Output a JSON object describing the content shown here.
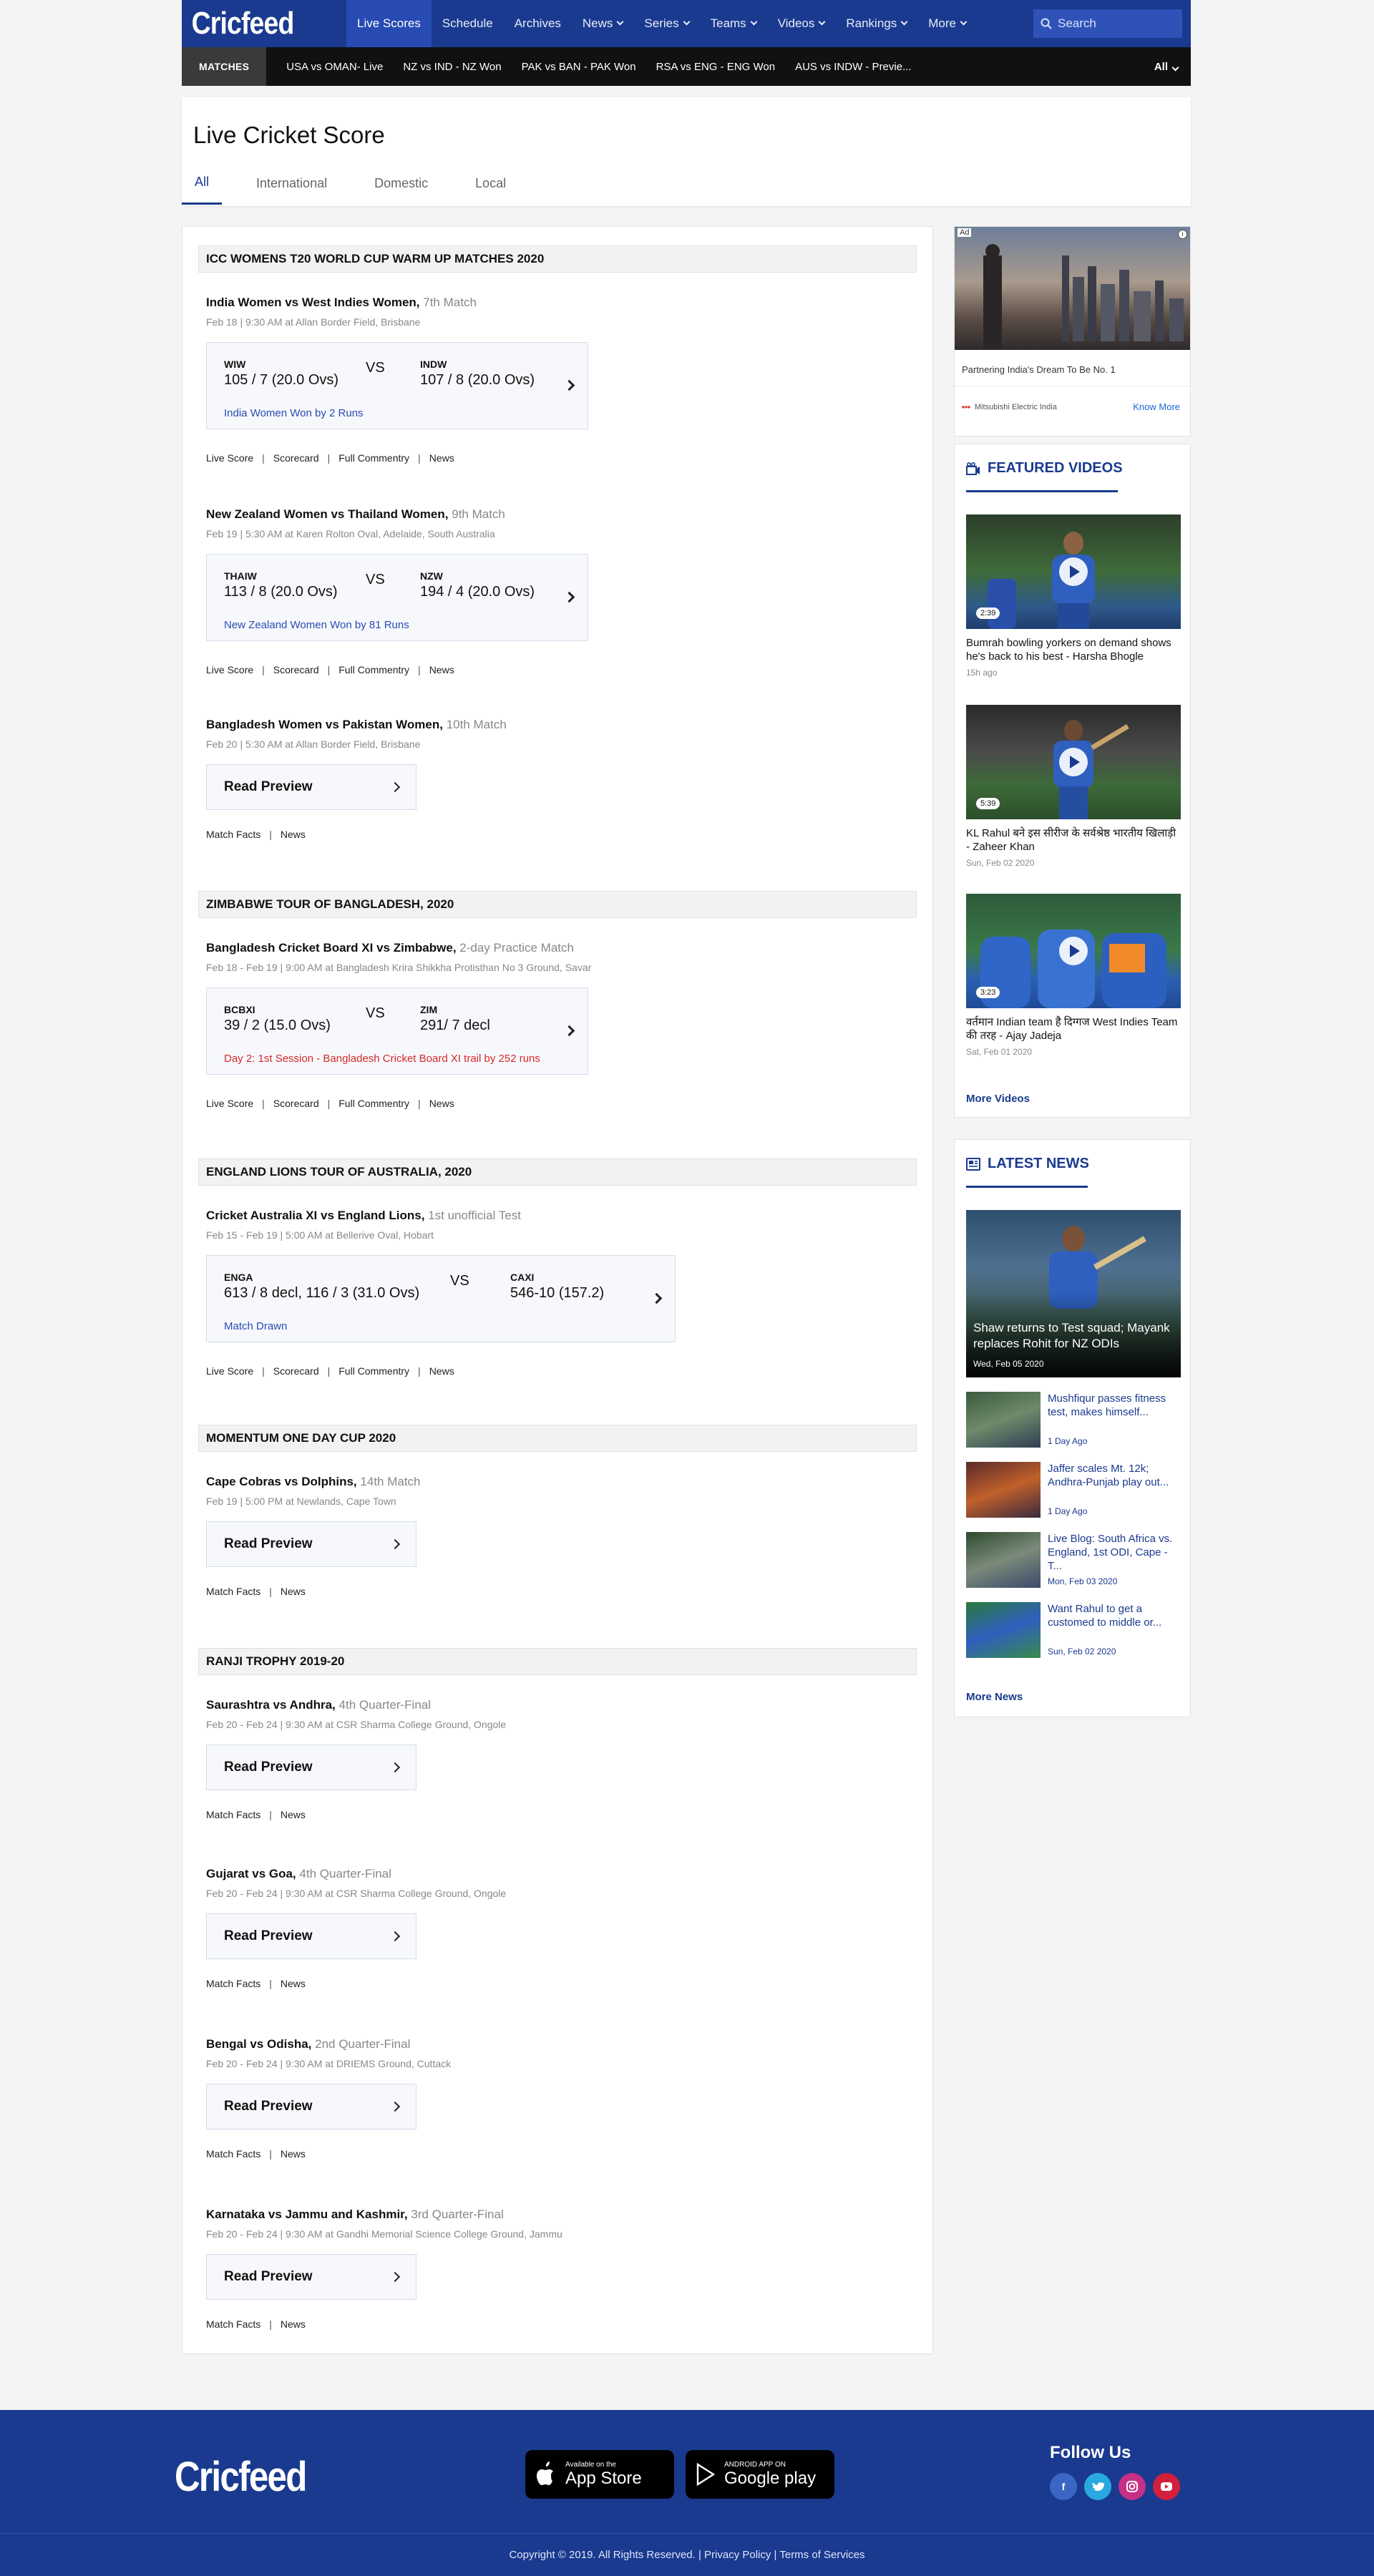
{
  "nav": {
    "logo": "Cricfeed",
    "items": [
      "Live Scores",
      "Schedule",
      "Archives",
      "News",
      "Series",
      "Teams",
      "Videos",
      "Rankings",
      "More"
    ],
    "search_placeholder": "Search"
  },
  "strip": {
    "label": "MATCHES",
    "matches": [
      "USA vs OMAN- Live",
      "NZ vs IND - NZ Won",
      "PAK vs BAN - PAK Won",
      "RSA vs  ENG - ENG Won",
      "AUS vs INDW - Previe..."
    ],
    "filter": "All"
  },
  "header": {
    "title": "Live Cricket Score",
    "tabs": [
      "All",
      "International",
      "Domestic",
      "Local"
    ]
  },
  "sections": [
    "ICC WOMENS T20 WORLD CUP WARM UP MATCHES 2020",
    "ZIMBABWE TOUR OF BANGLADESH, 2020",
    "ENGLAND LIONS TOUR OF AUSTRALIA, 2020",
    "MOMENTUM ONE DAY CUP 2020",
    "RANJI TROPHY 2019-20"
  ],
  "matches": [
    {
      "title": "India Women vs West Indies Women,",
      "num": "7th Match",
      "meta": "Feb 18  |  9:30 AM at Allan Border Field, Brisbane",
      "t1": "WIW",
      "s1": "105 / 7 (20.0 Ovs)",
      "vs": "VS",
      "t2": "INDW",
      "s2": "107 / 8 (20.0 Ovs)",
      "result": "India Women Won by 2 Runs",
      "links": [
        "Live Score",
        "Scorecard",
        "Full Commentry",
        "News"
      ]
    },
    {
      "title": "New Zealand Women vs Thailand Women,",
      "num": "9th Match",
      "meta": "Feb 19  |  5:30 AM at Karen Rolton Oval, Adelaide, South Australia",
      "t1": "THAIW",
      "s1": "113 / 8 (20.0 Ovs)",
      "vs": "VS",
      "t2": "NZW",
      "s2": "194 / 4 (20.0 Ovs)",
      "result": "New Zealand Women Won by 81 Runs",
      "links": [
        "Live Score",
        "Scorecard",
        "Full Commentry",
        "News"
      ]
    },
    {
      "title": "Bangladesh Women vs Pakistan Women,",
      "num": "10th Match",
      "meta": "Feb 20  |  5:30 AM at Allan Border Field, Brisbane",
      "preview": "Read Preview",
      "links": [
        "Match Facts",
        "News"
      ]
    },
    {
      "title": "Bangladesh Cricket Board XI vs Zimbabwe,",
      "num": "2-day Practice Match",
      "meta": "Feb 18 - Feb 19  |  9:00 AM at Bangladesh Krira Shikkha Protisthan No 3 Ground, Savar",
      "t1": "BCBXI",
      "s1": "39 / 2 (15.0 Ovs)",
      "vs": "VS",
      "t2": "ZIM",
      "s2": "291/ 7 decl",
      "result": "Day 2: 1st Session - Bangladesh Cricket Board XI trail by 252 runs",
      "links": [
        "Live Score",
        "Scorecard",
        "Full Commentry",
        "News"
      ]
    },
    {
      "title": "Cricket Australia XI vs England Lions,",
      "num": "1st unofficial Test",
      "meta": "Feb 15 - Feb 19  |  5:00 AM at Bellerive Oval, Hobart",
      "t1": "ENGA",
      "s1": "613 / 8 decl, 116 / 3 (31.0 Ovs)",
      "vs": "VS",
      "t2": "CAXI",
      "s2": "546-10 (157.2)",
      "result": "Match Drawn",
      "links": [
        "Live Score",
        "Scorecard",
        "Full Commentry",
        "News"
      ]
    },
    {
      "title": "Cape Cobras vs Dolphins,",
      "num": "14th Match",
      "meta": "Feb 19  |  5:00 PM at Newlands, Cape Town",
      "preview": "Read Preview",
      "links": [
        "Match Facts",
        "News"
      ]
    },
    {
      "title": "Saurashtra vs Andhra,",
      "num": "4th Quarter-Final",
      "meta": "Feb 20 - Feb 24  |  9:30 AM at CSR Sharma College Ground, Ongole",
      "preview": "Read Preview",
      "links": [
        "Match Facts",
        "News"
      ]
    },
    {
      "title": "Gujarat vs Goa,",
      "num": "4th Quarter-Final",
      "meta": "Feb 20 - Feb 24  |  9:30 AM at CSR Sharma College Ground, Ongole",
      "preview": "Read Preview",
      "links": [
        "Match Facts",
        "News"
      ]
    },
    {
      "title": "Bengal vs Odisha,",
      "num": "2nd Quarter-Final",
      "meta": "Feb 20 - Feb 24  |  9:30 AM at DRIEMS Ground, Cuttack",
      "preview": "Read Preview",
      "links": [
        "Match Facts",
        "News"
      ]
    },
    {
      "title": "Karnataka vs Jammu and Kashmir,",
      "num": "3rd Quarter-Final",
      "meta": "Feb 20 - Feb 24  |  9:30 AM at Gandhi Memorial Science College Ground, Jammu",
      "preview": "Read Preview",
      "links": [
        "Match Facts",
        "News"
      ]
    }
  ],
  "ad": {
    "tag": "Ad",
    "text": "Partnering India's Dream To Be No. 1",
    "source": "Mitsubishi Electric India",
    "cta": "Know More"
  },
  "videos": {
    "heading": "FEATURED VIDEOS",
    "items": [
      {
        "duration": "2:39",
        "title": "Bumrah bowling yorkers on demand shows he's back to his best - Harsha Bhogle",
        "time": "15h ago"
      },
      {
        "duration": "5:39",
        "title": "KL Rahul बने इस सीरीज के सर्वश्रेष्ठ भारतीय खिलाड़ी - Zaheer Khan",
        "time": "Sun, Feb 02 2020"
      },
      {
        "duration": "3:23",
        "title": "वर्तमान Indian team है दिग्गज West Indies Team की तरह - Ajay Jadeja",
        "time": "Sat, Feb 01 2020"
      }
    ],
    "more": "More Videos"
  },
  "news": {
    "heading": "LATEST NEWS",
    "lead": {
      "title": "Shaw returns to Test squad; Mayank replaces Rohit for NZ ODIs",
      "date": "Wed, Feb 05 2020"
    },
    "items": [
      {
        "title": "Mushfiqur passes fitness test, makes himself...",
        "time": "1 Day Ago"
      },
      {
        "title": "Jaffer scales Mt. 12k; Andhra-Punjab play out...",
        "time": "1 Day Ago"
      },
      {
        "title": "Live Blog: South Africa vs. England, 1st ODI, Cape - T...",
        "time": "Mon, Feb 03 2020"
      },
      {
        "title": "Want Rahul to get a customed to middle or...",
        "time": "Sun, Feb 02 2020"
      }
    ],
    "more": "More News"
  },
  "footer": {
    "logo": "Cricfeed",
    "appstore_small": "Available on the",
    "appstore_big": "App Store",
    "play_small": "ANDROID APP ON",
    "play_big": "Google play",
    "follow": "Follow Us",
    "copyright": "Copyright © 2019. All Rights Reserved.  |  Privacy Policy  |  Terms of Services"
  },
  "colors": {
    "brand": "#1a3a8f",
    "accent": "#274bb3",
    "alert": "#d62a2a"
  }
}
